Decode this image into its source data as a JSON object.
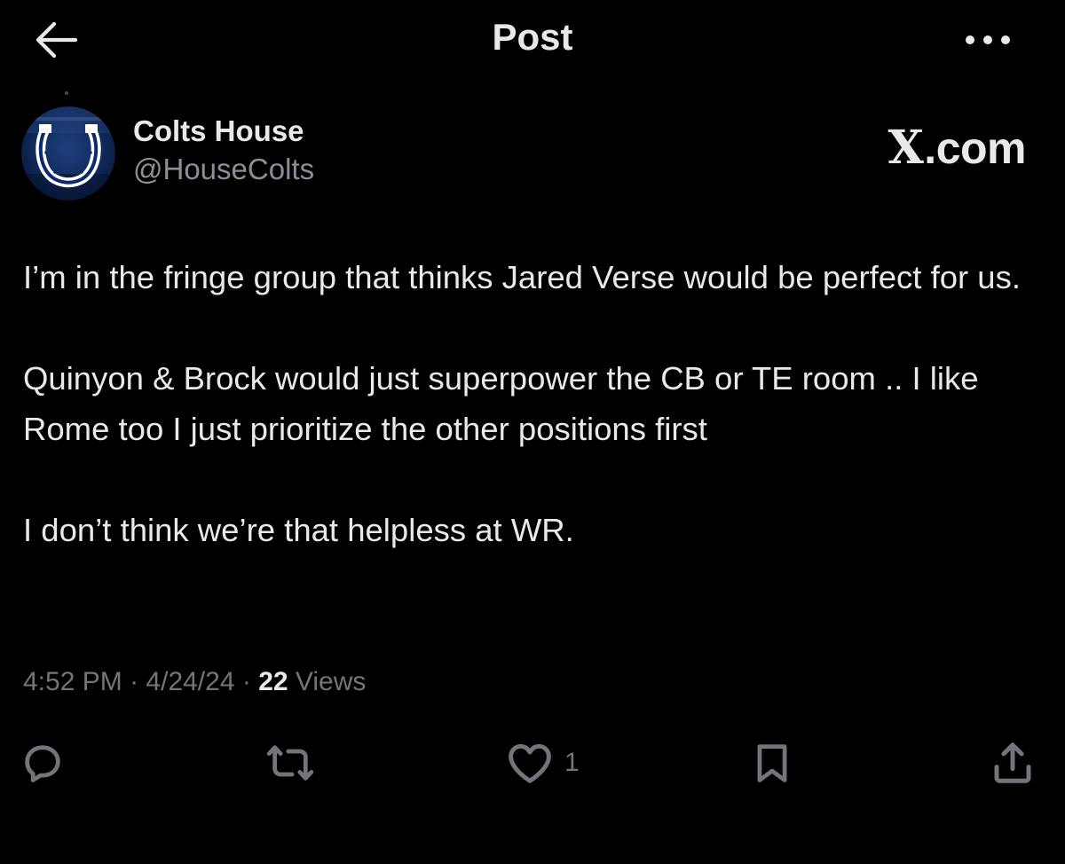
{
  "header": {
    "title": "Post",
    "back_icon": "arrow-left-icon",
    "more_icon": "more-horizontal-icon"
  },
  "author": {
    "name": "Colts House",
    "handle": "@HouseColts",
    "avatar_icon": "colts-horseshoe-logo"
  },
  "watermark": {
    "x": "X",
    "domain": ".com"
  },
  "post": {
    "paragraphs": [
      "I’m in the fringe group that thinks Jared Verse would be perfect for us.",
      "Quinyon & Brock would just superpower the CB or TE room .. I like Rome too I just prioritize the other positions first",
      "I don’t think we’re that helpless at WR."
    ]
  },
  "meta": {
    "time": "4:52 PM",
    "separator": "·",
    "date": "4/24/24",
    "views_count": "22",
    "views_label": "Views"
  },
  "actions": {
    "reply_icon": "reply-icon",
    "repost_icon": "repost-icon",
    "like_icon": "heart-icon",
    "like_count": "1",
    "bookmark_icon": "bookmark-icon",
    "share_icon": "share-icon"
  },
  "colors": {
    "background": "#000000",
    "primary_text": "#e7e9ea",
    "secondary_text": "#71767b",
    "avatar_blue": "#0a2a6e"
  }
}
